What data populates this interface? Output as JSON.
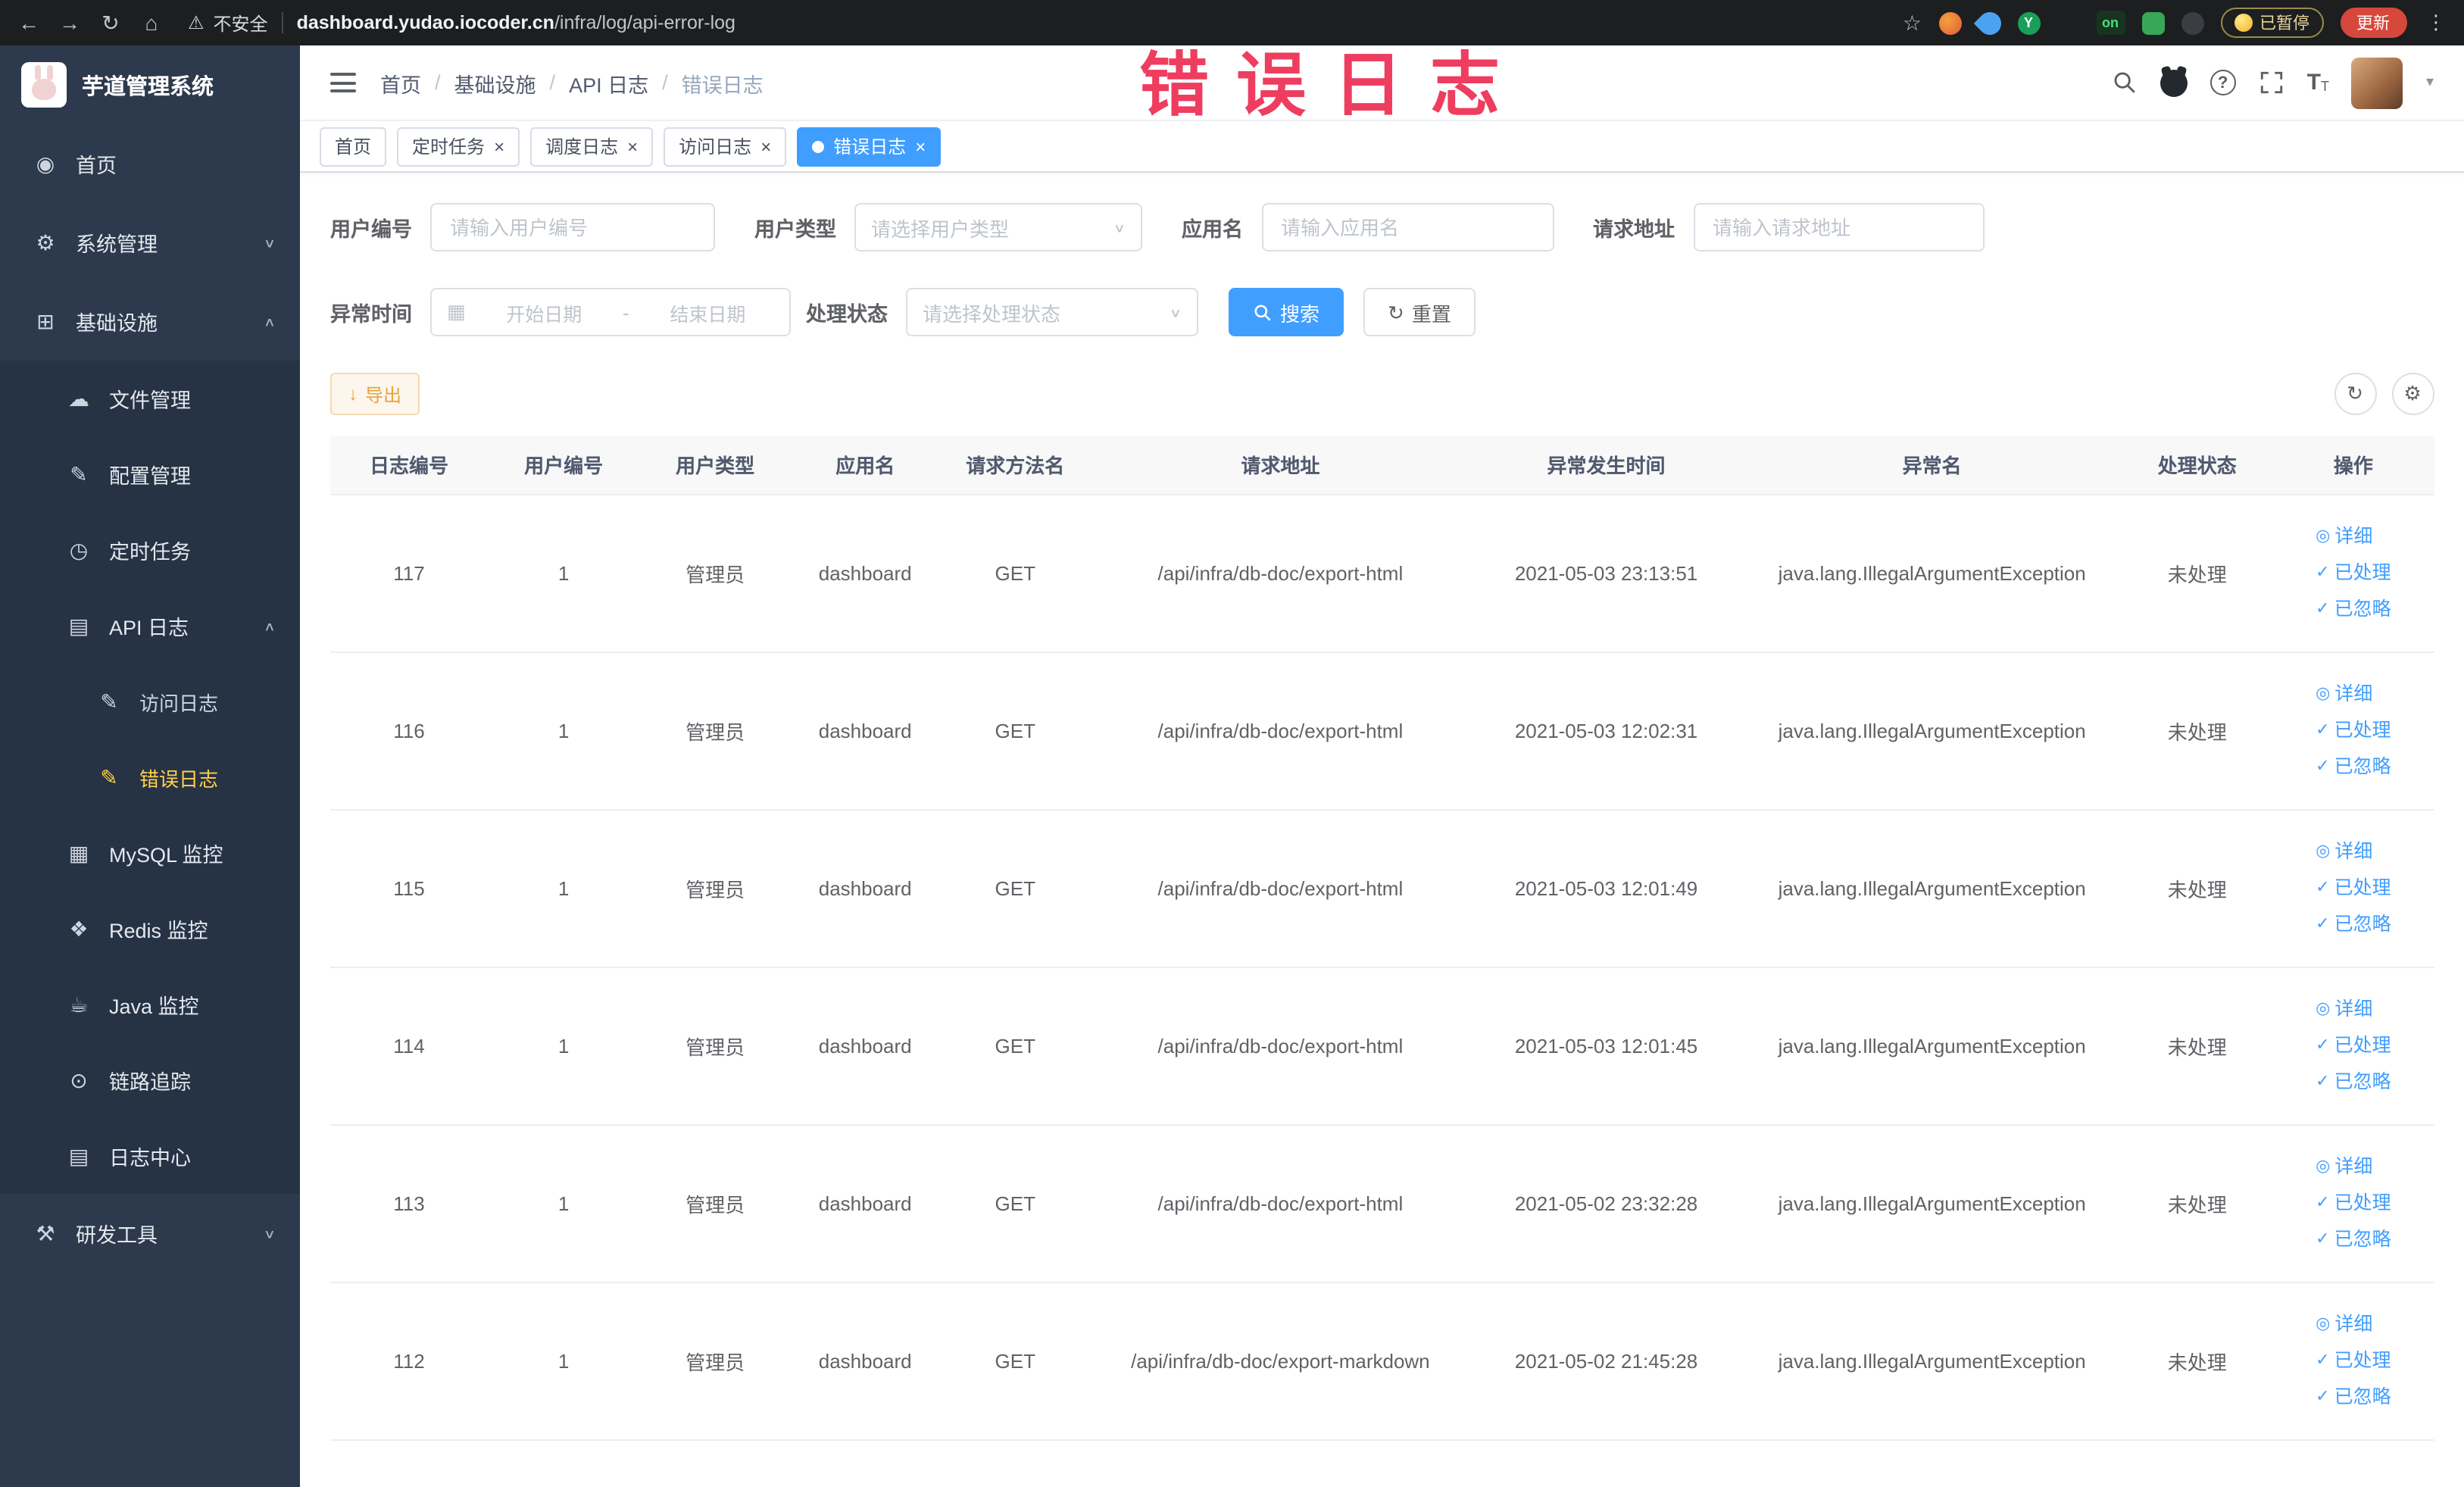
{
  "colors": {
    "accent": "#409eff",
    "sidebar_active": "#ffd04b",
    "annotation_red": "#ee3d5f",
    "export_warning": "#e6a23c"
  },
  "annotation": {
    "text": "错误日志"
  },
  "browser": {
    "security_label": "不安全",
    "url_domain": "dashboard.yudao.iocoder.cn",
    "url_path": "/infra/log/api-error-log",
    "extension_y_label": "Y",
    "extension_on_label": "on",
    "paused_badge_label": "已暂停",
    "update_button_label": "更新"
  },
  "sidebar": {
    "logo_title": "芋道管理系统",
    "items": [
      {
        "label": "首页",
        "icon": "dashboard-icon",
        "level": 1
      },
      {
        "label": "系统管理",
        "icon": "gear-icon",
        "level": 1,
        "chevron": "down"
      },
      {
        "label": "基础设施",
        "icon": "infrastructure-icon",
        "level": 1,
        "chevron": "up"
      },
      {
        "label": "文件管理",
        "icon": "cloud-icon",
        "level": 2
      },
      {
        "label": "配置管理",
        "icon": "edit-icon",
        "level": 2
      },
      {
        "label": "定时任务",
        "icon": "timer-icon",
        "level": 2
      },
      {
        "label": "API 日志",
        "icon": "api-log-icon",
        "level": 2,
        "chevron": "up"
      },
      {
        "label": "访问日志",
        "icon": "access-log-icon",
        "level": 3
      },
      {
        "label": "错误日志",
        "icon": "error-log-icon",
        "level": 3,
        "active": true
      },
      {
        "label": "MySQL 监控",
        "icon": "mysql-icon",
        "level": 2
      },
      {
        "label": "Redis 监控",
        "icon": "redis-icon",
        "level": 2
      },
      {
        "label": "Java 监控",
        "icon": "java-icon",
        "level": 2
      },
      {
        "label": "链路追踪",
        "icon": "trace-icon",
        "level": 2
      },
      {
        "label": "日志中心",
        "icon": "log-center-icon",
        "level": 2
      },
      {
        "label": "研发工具",
        "icon": "devtools-icon",
        "level": 1,
        "chevron": "down"
      }
    ]
  },
  "header": {
    "breadcrumb": [
      "首页",
      "基础设施",
      "API 日志",
      "错误日志"
    ]
  },
  "tabs": [
    {
      "label": "首页",
      "closable": false,
      "active": false
    },
    {
      "label": "定时任务",
      "closable": true,
      "active": false
    },
    {
      "label": "调度日志",
      "closable": true,
      "active": false
    },
    {
      "label": "访问日志",
      "closable": true,
      "active": false
    },
    {
      "label": "错误日志",
      "closable": true,
      "active": true
    }
  ],
  "filters": {
    "user_id": {
      "label": "用户编号",
      "placeholder": "请输入用户编号"
    },
    "user_type": {
      "label": "用户类型",
      "placeholder": "请选择用户类型"
    },
    "app_name": {
      "label": "应用名",
      "placeholder": "请输入应用名"
    },
    "request_url": {
      "label": "请求地址",
      "placeholder": "请输入请求地址"
    },
    "exception_time": {
      "label": "异常时间",
      "start_placeholder": "开始日期",
      "separator": "-",
      "end_placeholder": "结束日期"
    },
    "process_status": {
      "label": "处理状态",
      "placeholder": "请选择处理状态"
    },
    "search_button": "搜索",
    "reset_button": "重置"
  },
  "toolbar": {
    "export_button": "导出"
  },
  "table": {
    "columns": [
      "日志编号",
      "用户编号",
      "用户类型",
      "应用名",
      "请求方法名",
      "请求地址",
      "异常发生时间",
      "异常名",
      "处理状态",
      "操作"
    ],
    "action_detail": "详细",
    "action_processed": "已处理",
    "action_ignored": "已忽略",
    "rows": [
      {
        "id": "117",
        "user_id": "1",
        "user_type": "管理员",
        "app": "dashboard",
        "method": "GET",
        "url": "/api/infra/db-doc/export-html",
        "time": "2021-05-03 23:13:51",
        "exception": "java.lang.IllegalArgumentException",
        "status": "未处理"
      },
      {
        "id": "116",
        "user_id": "1",
        "user_type": "管理员",
        "app": "dashboard",
        "method": "GET",
        "url": "/api/infra/db-doc/export-html",
        "time": "2021-05-03 12:02:31",
        "exception": "java.lang.IllegalArgumentException",
        "status": "未处理"
      },
      {
        "id": "115",
        "user_id": "1",
        "user_type": "管理员",
        "app": "dashboard",
        "method": "GET",
        "url": "/api/infra/db-doc/export-html",
        "time": "2021-05-03 12:01:49",
        "exception": "java.lang.IllegalArgumentException",
        "status": "未处理"
      },
      {
        "id": "114",
        "user_id": "1",
        "user_type": "管理员",
        "app": "dashboard",
        "method": "GET",
        "url": "/api/infra/db-doc/export-html",
        "time": "2021-05-03 12:01:45",
        "exception": "java.lang.IllegalArgumentException",
        "status": "未处理"
      },
      {
        "id": "113",
        "user_id": "1",
        "user_type": "管理员",
        "app": "dashboard",
        "method": "GET",
        "url": "/api/infra/db-doc/export-html",
        "time": "2021-05-02 23:32:28",
        "exception": "java.lang.IllegalArgumentException",
        "status": "未处理"
      },
      {
        "id": "112",
        "user_id": "1",
        "user_type": "管理员",
        "app": "dashboard",
        "method": "GET",
        "url": "/api/infra/db-doc/export-markdown",
        "time": "2021-05-02 21:45:28",
        "exception": "java.lang.IllegalArgumentException",
        "status": "未处理"
      }
    ]
  }
}
